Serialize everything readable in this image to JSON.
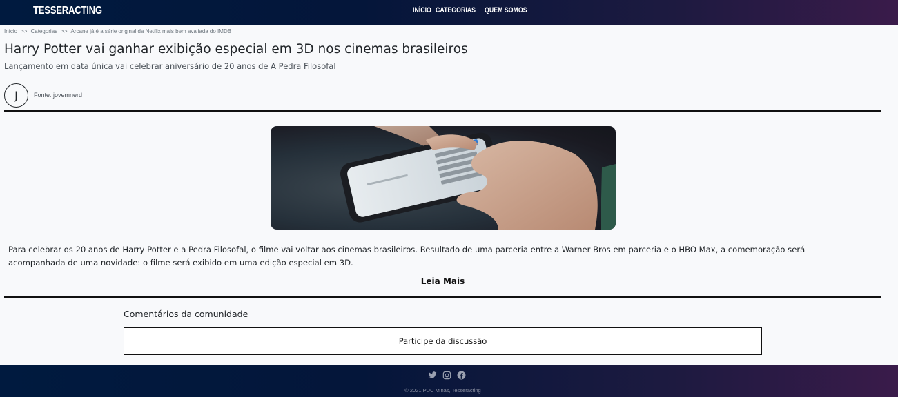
{
  "header": {
    "brand": "TESSERACTING",
    "nav": [
      {
        "label": "INÍCIO"
      },
      {
        "label": "CATEGORIAS"
      },
      {
        "label": "QUEM SOMOS"
      }
    ]
  },
  "breadcrumb": {
    "items": [
      "Início",
      "Categorias",
      "Arcane já é a série original da Netflix mais bem avaliada do IMDB"
    ],
    "separator": ">>"
  },
  "article": {
    "title": "Harry Potter vai ganhar exibição especial em 3D nos cinemas brasileiros",
    "subtitle": "Lançamento em data única vai celebrar aniversário de 20 anos de A Pedra Filosofal",
    "author_initial": "J",
    "source": "Fonte: jovemnerd",
    "body": "Para celebrar os 20 anos de Harry Potter e a Pedra Filosofal, o filme vai voltar aos cinemas brasileiros. Resultado de uma parceria entre a Warner Bros em parceria e o HBO Max, a comemoração será acompanhada de uma novidade: o filme será exibido em uma edição especial em 3D.",
    "read_more": "Leia Mais"
  },
  "comments": {
    "title": "Comentários da comunidade",
    "button": "Participe da discussão"
  },
  "footer": {
    "social_icons": [
      "twitter-icon",
      "instagram-icon",
      "facebook-icon"
    ],
    "copyright": "© 2021 PUC Minas, Tesseracting"
  },
  "colors": {
    "header_gradient_start": "#001a3f",
    "header_gradient_end": "#3a1b4a",
    "background": "#f8f9fb"
  }
}
